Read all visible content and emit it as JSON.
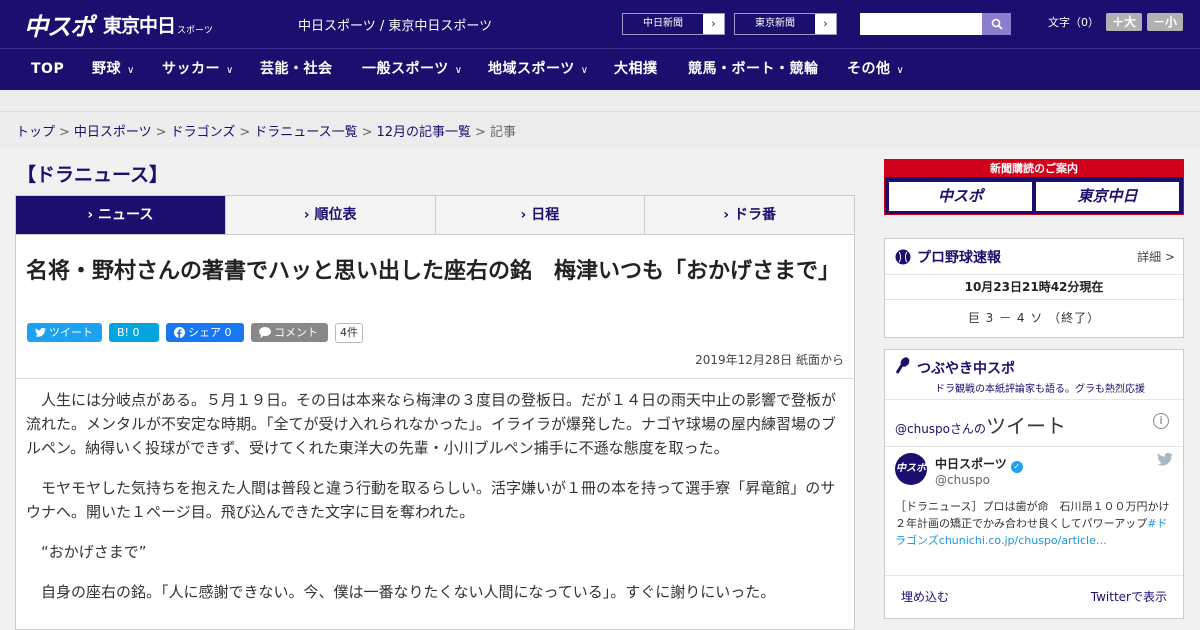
{
  "header": {
    "logo_main": "中スポ",
    "logo_second": "東京中日",
    "logo_second_small": "スポーツ",
    "site_title": "中日スポーツ / 東京中日スポーツ",
    "ext_links": [
      {
        "label": "中日新聞",
        "arrow": "›"
      },
      {
        "label": "東京新聞",
        "arrow": "›"
      }
    ],
    "search_placeholder": "",
    "font_label": "文字（0）",
    "font_plus": "＋大",
    "font_minus": "－小"
  },
  "nav": {
    "items": [
      {
        "label": "TOP",
        "chev": ""
      },
      {
        "label": "野球",
        "chev": "∨"
      },
      {
        "label": "サッカー",
        "chev": "∨"
      },
      {
        "label": "芸能・社会",
        "chev": ""
      },
      {
        "label": "一般スポーツ",
        "chev": "∨"
      },
      {
        "label": "地域スポーツ",
        "chev": "∨"
      },
      {
        "label": "大相撲",
        "chev": ""
      },
      {
        "label": "競馬・ボート・競輪",
        "chev": ""
      },
      {
        "label": "その他",
        "chev": "∨"
      }
    ]
  },
  "breadcrumb": {
    "items": [
      "トップ",
      "中日スポーツ",
      "ドラゴンズ",
      "ドラニュース一覧",
      "12月の記事一覧"
    ],
    "current": "記事",
    "sep": ">"
  },
  "section_title": "【ドラニュース】",
  "tabs": [
    {
      "label": "› ニュース"
    },
    {
      "label": "› 順位表"
    },
    {
      "label": "› 日程"
    },
    {
      "label": "› ドラ番"
    }
  ],
  "article": {
    "headline": "名将・野村さんの著書でハッと思い出した座右の銘　梅津いつも「おかげさまで」",
    "share": {
      "tweet": "ツイート",
      "hatena": "B! 0",
      "facebook": "シェア 0",
      "comment": "コメント",
      "comment_count": "4件"
    },
    "date": "2019年12月28日 紙面から",
    "paragraphs": [
      "人生には分岐点がある。５月１９日。その日は本来なら梅津の３度目の登板日。だが１４日の雨天中止の影響で登板が流れた。メンタルが不安定な時期。「全てが受け入れられなかった」。イライラが爆発した。ナゴヤ球場の屋内練習場のブルペン。納得いく投球ができず、受けてくれた東洋大の先輩・小川ブルペン捕手に不遜な態度を取った。",
      "モヤモヤした気持ちを抱えた人間は普段と違う行動を取るらしい。活字嫌いが１冊の本を持って選手寮「昇竜館」のサウナへ。開いた１ページ目。飛び込んできた文字に目を奪われた。",
      "“おかげさまで”",
      "自身の座右の銘。「人に感謝できない。今、僕は一番なりたくない人間になっている」。すぐに謝りにいった。"
    ]
  },
  "sidebar": {
    "subscribe": {
      "header": "新聞購読のご案内",
      "logo1": "中スポ",
      "logo2": "東京中日"
    },
    "baseball": {
      "title": "プロ野球速報",
      "detail": "詳細 >",
      "updated": "10月23日21時42分現在",
      "score": "巨 3 － 4 ソ （終了）"
    },
    "tweets": {
      "title": "つぶやき中スポ",
      "desc": "ドラ観戦の本紙評論家も語る。グラも熱烈応援",
      "handle_prefix": "@chuspo",
      "san": "さんの",
      "tweet_word": "ツイート",
      "info": "i",
      "avatar": "中スポ",
      "name": "中日スポーツ",
      "verified": "✓",
      "handle": "@chuspo",
      "bird": "🐦",
      "text_plain": "［ドラニュース］プロは歯が命　石川昂１００万円かけ２年計画の矯正でかみ合わせ良くしてパワーアップ",
      "text_link": "#ドラゴンズchunichi.co.jp/chuspo/article…",
      "embed": "埋め込む",
      "view_on_twitter": "Twitterで表示"
    }
  }
}
